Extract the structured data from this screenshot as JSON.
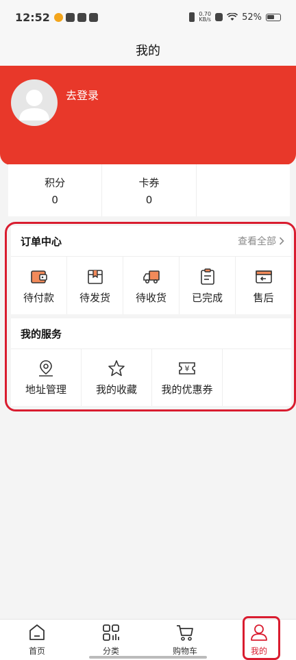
{
  "status_bar": {
    "time": "12:52",
    "net_speed_value": "0.70",
    "net_speed_unit": "KB/s",
    "battery": "52%"
  },
  "header": {
    "title": "我的"
  },
  "profile": {
    "login_text": "去登录"
  },
  "stats": [
    {
      "label": "积分",
      "value": "0"
    },
    {
      "label": "卡券",
      "value": "0"
    }
  ],
  "orders": {
    "title": "订单中心",
    "view_all": "查看全部",
    "items": [
      {
        "label": "待付款",
        "icon": "wallet-icon"
      },
      {
        "label": "待发货",
        "icon": "box-icon"
      },
      {
        "label": "待收货",
        "icon": "truck-icon"
      },
      {
        "label": "已完成",
        "icon": "clipboard-icon"
      },
      {
        "label": "售后",
        "icon": "return-icon"
      }
    ]
  },
  "services": {
    "title": "我的服务",
    "items": [
      {
        "label": "地址管理",
        "icon": "location-icon"
      },
      {
        "label": "我的收藏",
        "icon": "star-icon"
      },
      {
        "label": "我的优惠券",
        "icon": "coupon-icon"
      }
    ]
  },
  "tabbar": {
    "items": [
      {
        "label": "首页",
        "icon": "home-icon"
      },
      {
        "label": "分类",
        "icon": "category-icon"
      },
      {
        "label": "购物车",
        "icon": "cart-icon"
      },
      {
        "label": "我的",
        "icon": "user-icon",
        "active": true
      }
    ]
  },
  "colors": {
    "brand_red": "#e8382a",
    "highlight_red": "#d91c2f",
    "accent_orange": "#f28a5a"
  }
}
